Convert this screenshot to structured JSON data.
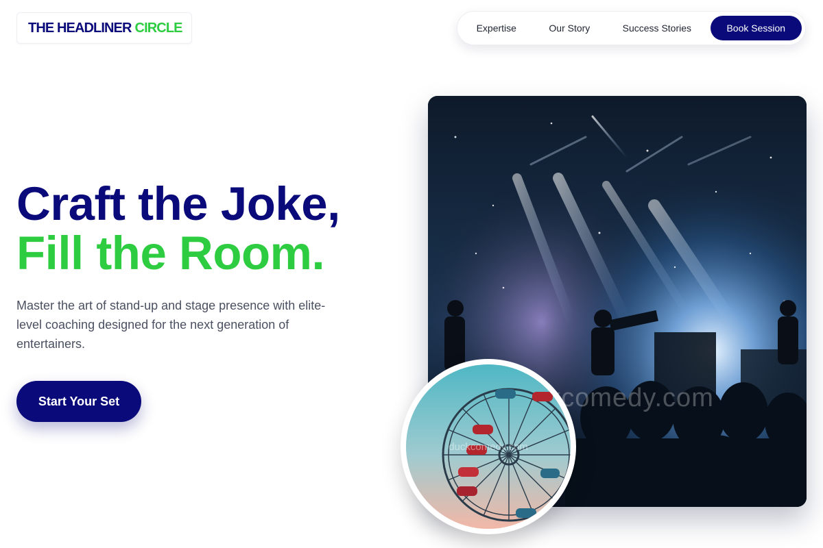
{
  "brand": {
    "part1": "THE HEADLINER",
    "part2": "CIRCLE"
  },
  "nav": {
    "items": [
      "Expertise",
      "Our Story",
      "Success Stories"
    ],
    "cta": "Book Session"
  },
  "hero": {
    "headline_line1": "Craft the Joke,",
    "headline_line2": "Fill the Room.",
    "subtitle": "Master the art of stand-up and stage presence with elite-level coaching designed for the next generation of entertainers.",
    "cta": "Start Your Set"
  },
  "images": {
    "watermark_large": "duckcomedy.com",
    "watermark_small": "duckcomedy.com"
  },
  "colors": {
    "navy": "#0a0a7a",
    "green": "#2ecc40",
    "text_muted": "#4a5060"
  }
}
